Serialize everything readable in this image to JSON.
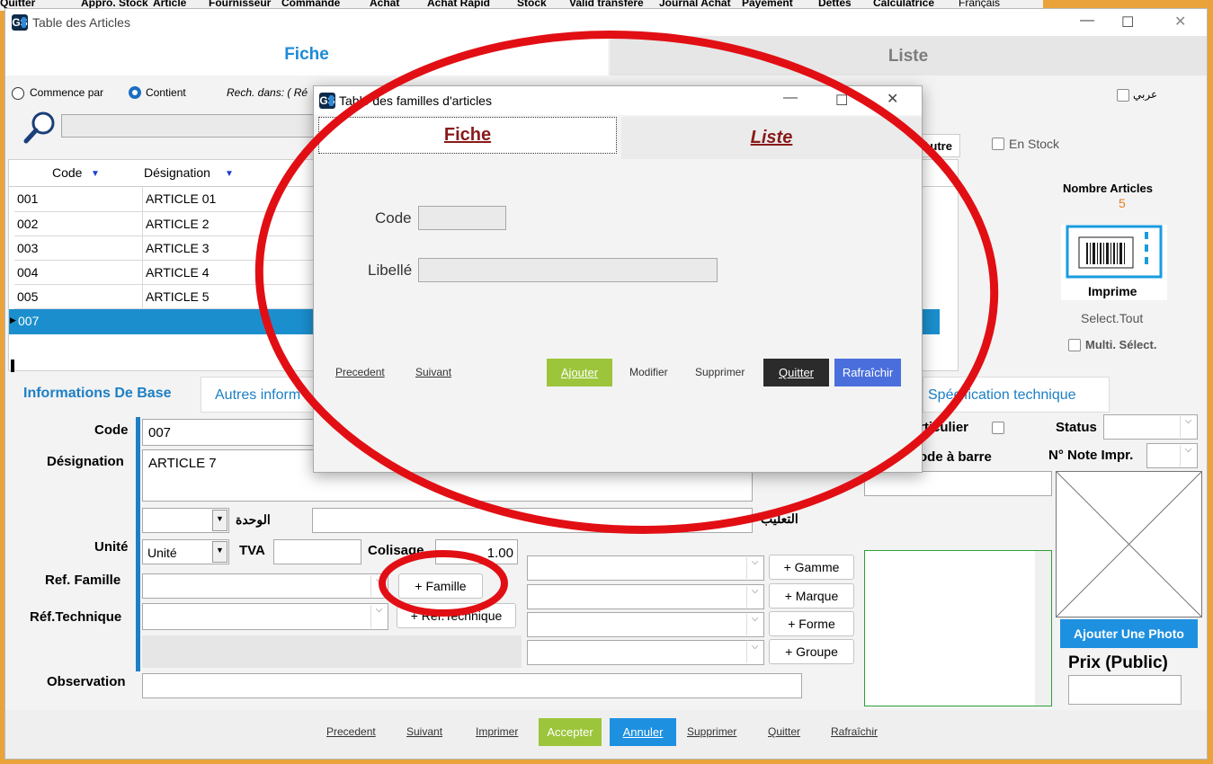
{
  "bg_menu": [
    "Quitter",
    "Appro. Stock",
    "Article",
    "Fournisseur",
    "Commande",
    "Achat",
    "Achat Rapid",
    "Stock",
    "Valid transfére",
    "Journal Achat",
    "Payement",
    "Dettes",
    "Calculatrice",
    "Français"
  ],
  "main_window": {
    "title": "Table des Articles",
    "logo": "GS",
    "controls": {
      "minimize": "—",
      "maximize": "☐",
      "close": "✕"
    },
    "tabs": {
      "fiche": "Fiche",
      "liste": "Liste"
    }
  },
  "search": {
    "option_starts": "Commence par",
    "option_contains": "Contient",
    "selected": "Contient",
    "search_in_label": "Rech. dans: ( Ré",
    "search_icon": "magnifier-icon"
  },
  "filters": {
    "arabic_label": "عربي",
    "in_stock_label": "En Stock",
    "autre_label": "Autre"
  },
  "grid": {
    "headers": {
      "code": "Code",
      "designation": "Désignation"
    },
    "rows": [
      {
        "code": "001",
        "designation": "ARTICLE 01"
      },
      {
        "code": "002",
        "designation": "ARTICLE 2"
      },
      {
        "code": "003",
        "designation": "ARTICLE 3"
      },
      {
        "code": "004",
        "designation": "ARTICLE 4"
      },
      {
        "code": "005",
        "designation": "ARTICLE 5"
      },
      {
        "code": "007",
        "designation": ""
      }
    ],
    "selected_row": 5
  },
  "side_panel": {
    "count_label": "Nombre Articles",
    "count_value": "5",
    "print_label": "Imprime",
    "select_all": "Select.Tout",
    "multi_select": "Multi. Sélect."
  },
  "section_tabs": {
    "base_info": "Informations De Base",
    "other_info": "Autres inform",
    "tech_spec": "Spécification technique"
  },
  "form": {
    "code_label": "Code",
    "code_value": "007",
    "designation_label": "Désignation",
    "designation_value": "ARTICLE 7",
    "unit_ar_label": "الوحدة",
    "packaging_ar_label": "التعليب",
    "unit_label": "Unité",
    "unit_value": "Unité",
    "tva_label": "TVA",
    "tva_value": "",
    "colisage_label": "Colisage",
    "colisage_value": "1.00",
    "ref_famille_label": "Ref. Famille",
    "famille_button": "+ Famille",
    "ref_tech_label": "Réf.Technique",
    "ref_tech_button": "+ Réf.Technique",
    "observation_label": "Observation",
    "gamme_button": "+ Gamme",
    "marque_button": "+ Marque",
    "forme_button": "+ Forme",
    "groupe_button": "+ Groupe",
    "particulier_label": "rticulier",
    "barcode_label": "ode à barre",
    "status_label": "Status",
    "note_label": "N° Note Impr.",
    "add_photo_button": "Ajouter Une Photo",
    "price_label": "Prix (Public)"
  },
  "bottom_bar": {
    "precedent": "Precedent",
    "suivant": "Suivant",
    "imprimer": "Imprimer",
    "accepter": "Accepter",
    "annuler": "Annuler",
    "supprimer": "Supprimer",
    "quitter": "Quitter",
    "rafraichir": "Rafraîchir"
  },
  "modal": {
    "title": "Table des familles d'articles",
    "logo": "GS",
    "controls": {
      "minimize": "—",
      "maximize": "☐",
      "close": "✕"
    },
    "tab_fiche": "Fiche",
    "tab_liste": "Liste",
    "code_label": "Code",
    "code_value": "",
    "libelle_label": "Libellé",
    "libelle_value": "",
    "buttons": {
      "precedent": "Precedent",
      "suivant": "Suivant",
      "ajouter": "Ajouter",
      "modifier": "Modifier",
      "supprimer": "Supprimer",
      "quitter": "Quitter",
      "rafraichir": "Rafraîchir"
    }
  },
  "colors": {
    "accent_blue": "#1d8ad6",
    "selected_row": "#1b8fce",
    "green_button": "#9cc53b",
    "blue_button": "#1e90e0",
    "dark_button": "#2b2b2b",
    "purple_button": "#4a6fdc",
    "annotation_red": "#e10f14",
    "window_border": "#e9a33a"
  }
}
